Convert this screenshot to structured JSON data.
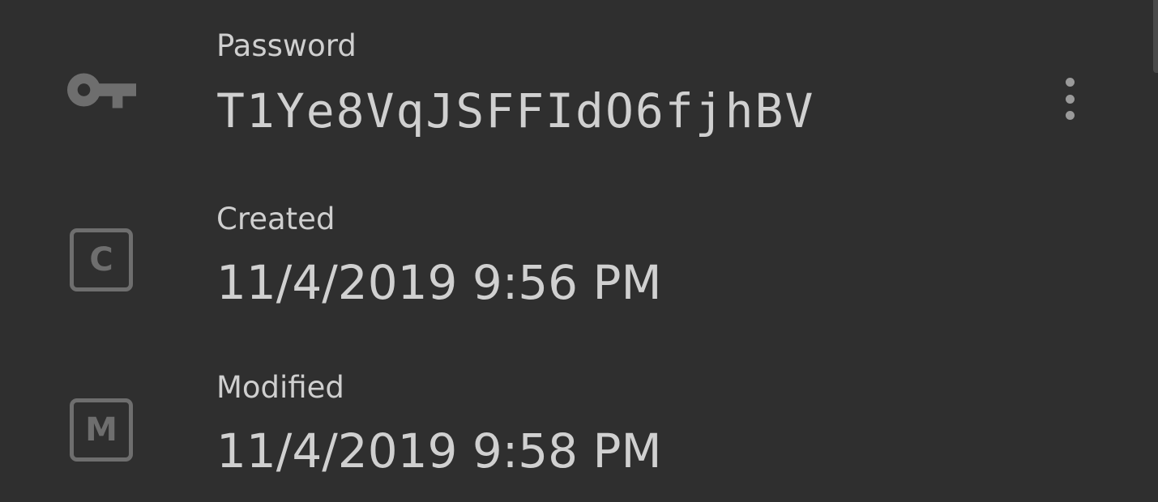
{
  "password": {
    "label": "Password",
    "value": "T1Ye8VqJSFFIdO6fjhBV",
    "icon": "key-icon",
    "menu_icon": "more-vertical-icon"
  },
  "created": {
    "label": "Created",
    "value": "11/4/2019 9:56 PM",
    "icon_letter": "C",
    "icon": "created-icon"
  },
  "modified": {
    "label": "Modified",
    "value": "11/4/2019 9:58 PM",
    "icon_letter": "M",
    "icon": "modified-icon"
  },
  "colors": {
    "background": "#2f2f2f",
    "text": "#d0d0d0",
    "icon": "#6e6e6e"
  }
}
